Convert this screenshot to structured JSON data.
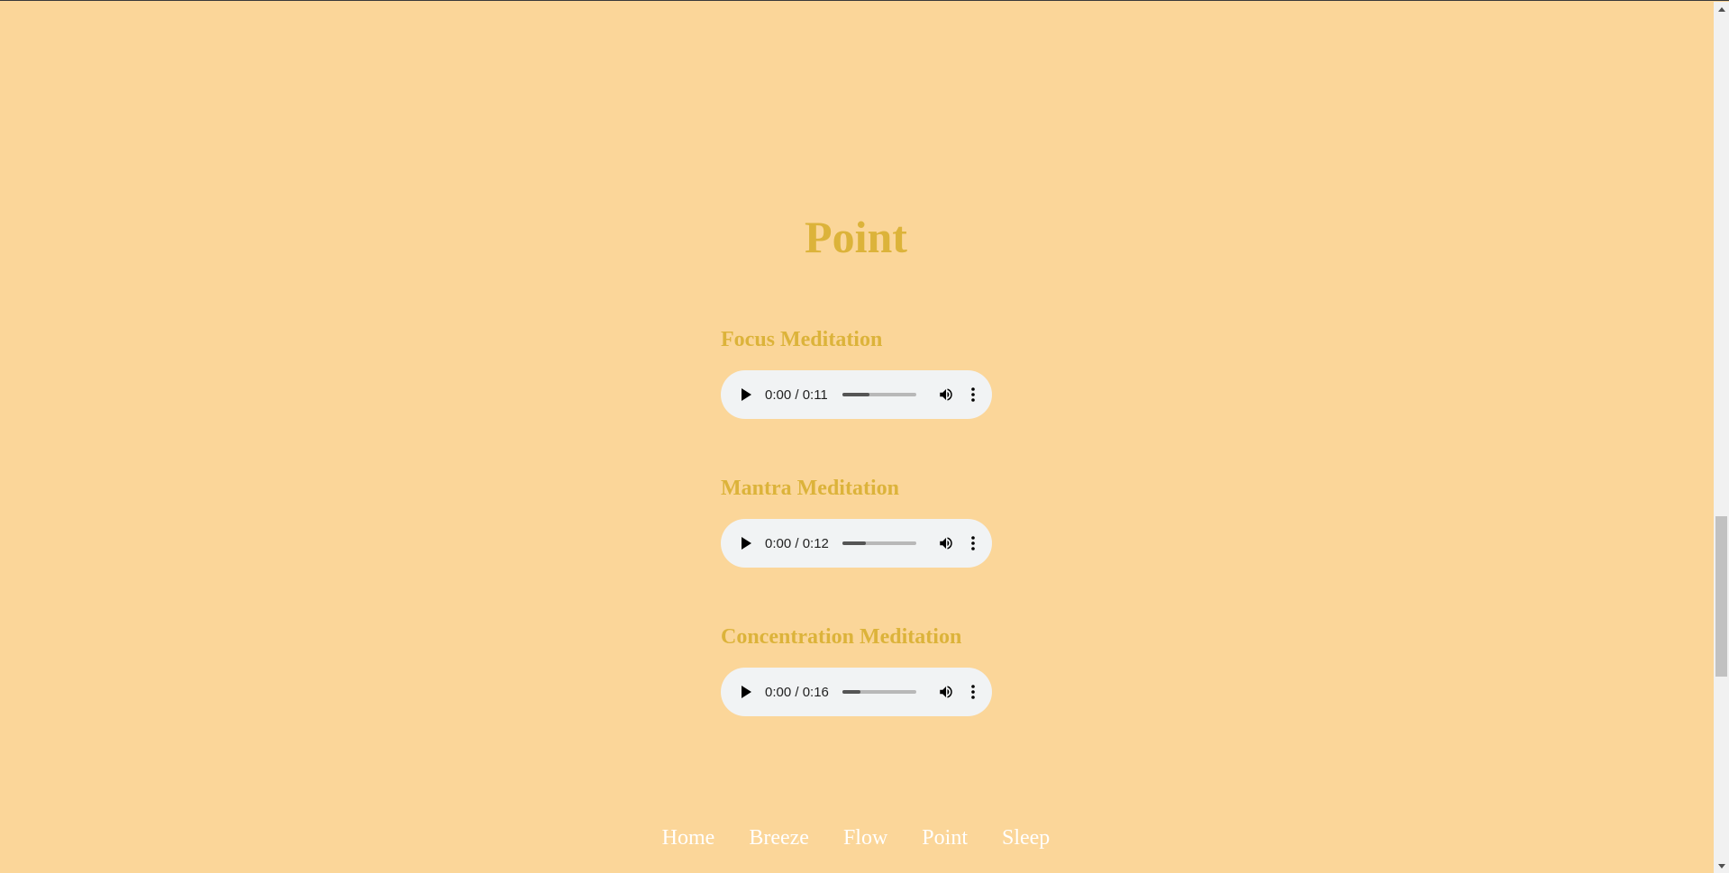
{
  "page": {
    "title": "Point"
  },
  "tracks": [
    {
      "title": "Focus Meditation",
      "time": "0:00 / 0:11",
      "buffered": 0.36
    },
    {
      "title": "Mantra Meditation",
      "time": "0:00 / 0:12",
      "buffered": 0.32
    },
    {
      "title": "Concentration Meditation",
      "time": "0:00 / 0:16",
      "buffered": 0.24
    }
  ],
  "nav": {
    "items": [
      {
        "label": "Home"
      },
      {
        "label": "Breeze"
      },
      {
        "label": "Flow"
      },
      {
        "label": "Point"
      },
      {
        "label": "Sleep"
      }
    ]
  },
  "colors": {
    "background": "#fbd699",
    "heading": "#dcb33a",
    "nav_text": "#ffffff",
    "player_bg": "#f1f3f4"
  },
  "icons": {
    "play": "play-icon",
    "volume": "volume-icon",
    "more": "more-vertical-icon",
    "scroll_up": "scroll-up-arrow-icon",
    "scroll_down": "scroll-down-arrow-icon"
  }
}
